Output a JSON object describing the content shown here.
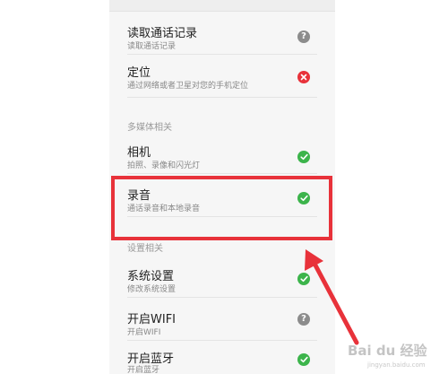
{
  "permissions": [
    {
      "title": "读取通话记录",
      "subtitle": "读取通话记录",
      "status": "ask"
    },
    {
      "title": "定位",
      "subtitle": "通过网络或者卫星对您的手机定位",
      "status": "deny"
    },
    {
      "title": "相机",
      "subtitle": "拍照、录像和闪光灯",
      "status": "allow"
    },
    {
      "title": "录音",
      "subtitle": "通话录音和本地录音",
      "status": "allow"
    },
    {
      "title": "系统设置",
      "subtitle": "修改系统设置",
      "status": "allow"
    },
    {
      "title": "开启WIFI",
      "subtitle": "开启WIFI",
      "status": "ask"
    },
    {
      "title": "开启蓝牙",
      "subtitle": "开启蓝牙",
      "status": "allow"
    }
  ],
  "sections": {
    "multimedia": "多媒体相关",
    "settings": "设置相关"
  },
  "status_icons": {
    "allow": {
      "icon": "check-circle-icon",
      "color": "#3cb44b"
    },
    "deny": {
      "icon": "x-circle-icon",
      "color": "#e8323a"
    },
    "ask": {
      "icon": "question-circle-icon",
      "color": "#8c8c8c"
    }
  },
  "annotation": {
    "highlight_color": "#e8323a"
  },
  "watermark": {
    "text": "Bai du 经验",
    "url": "jingyan.baidu.com"
  }
}
